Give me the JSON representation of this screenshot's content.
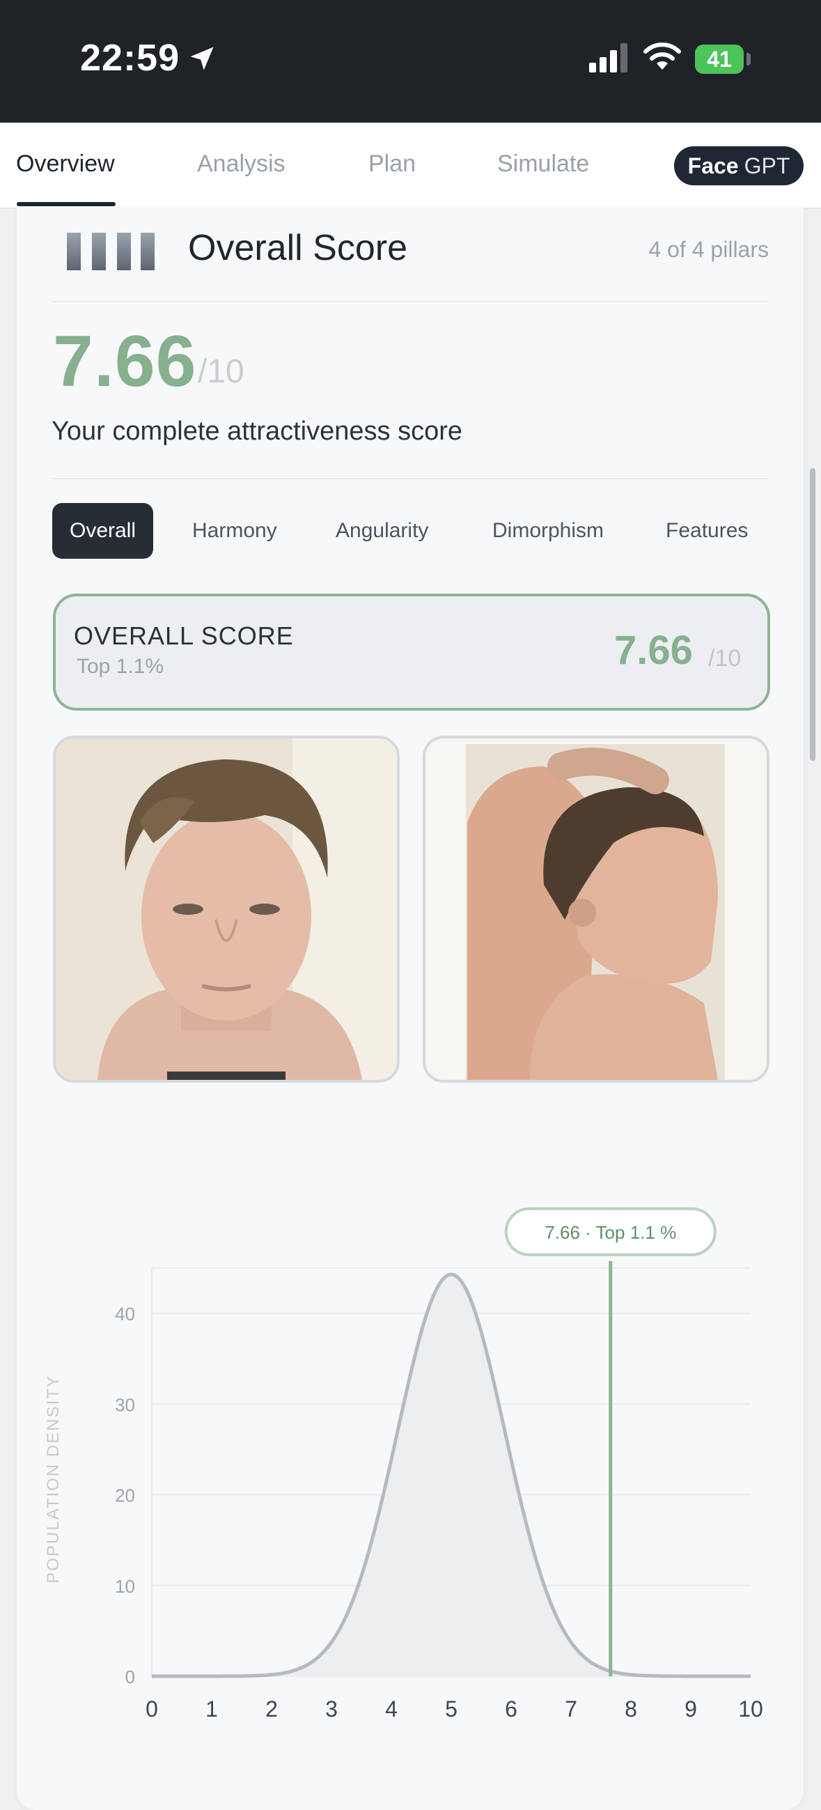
{
  "status_bar": {
    "time": "22:59",
    "battery": "41"
  },
  "nav": {
    "tabs": [
      "Overview",
      "Analysis",
      "Plan",
      "Simulate"
    ],
    "active_tab": "Overview",
    "facegpt_bold": "Face",
    "facegpt_rest": "GPT"
  },
  "card": {
    "title": "Overall Score",
    "pillars": "4 of 4 pillars",
    "score": "7.66",
    "denom": "/10",
    "description": "Your complete attractiveness score"
  },
  "subtabs": [
    "Overall",
    "Harmony",
    "Angularity",
    "Dimorphism",
    "Features"
  ],
  "overall_box": {
    "title": "OVERALL SCORE",
    "top": "Top 1.1%",
    "score": "7.66",
    "denom": "/10"
  },
  "icons": [
    "location-arrow-icon",
    "signal-icon",
    "wifi-icon",
    "battery-icon",
    "pillars-icon"
  ],
  "colors": {
    "accent": "#86b08e",
    "dark": "#1e2733",
    "curve": "#b5bac0"
  },
  "chart_data": {
    "type": "area",
    "ylabel": "POPULATION DENSITY",
    "xlabel": "",
    "x_ticks": [
      0,
      1,
      2,
      3,
      4,
      5,
      6,
      7,
      8,
      9,
      10
    ],
    "y_ticks": [
      0,
      10,
      20,
      30,
      40
    ],
    "xlim": [
      0,
      10
    ],
    "ylim": [
      0,
      45
    ],
    "distribution": {
      "kind": "normal",
      "mean": 5.0,
      "sd": 0.9,
      "peak": 44.3
    },
    "marker": {
      "x": 7.66,
      "label": "7.66 · Top 1.1 %"
    },
    "grid": true
  }
}
